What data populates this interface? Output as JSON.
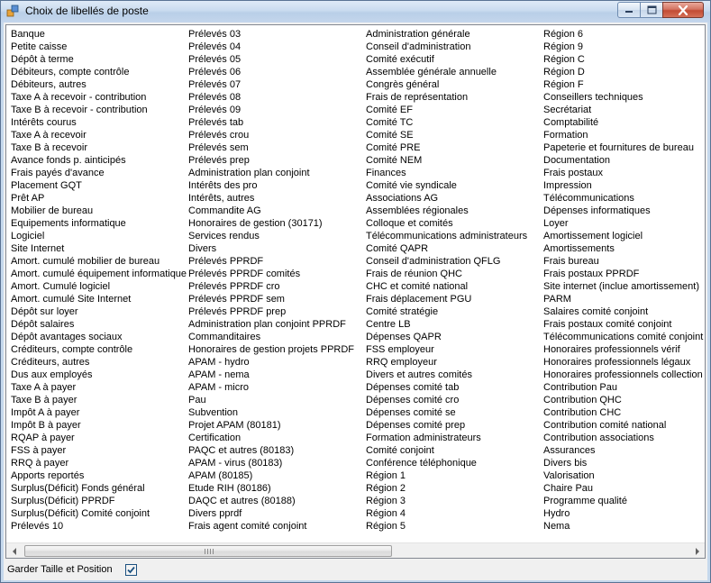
{
  "window": {
    "title": "Choix de libellés de poste"
  },
  "list": {
    "columns": [
      [
        "Banque",
        "Petite caisse",
        "Dépôt à terme",
        "Débiteurs, compte contrôle",
        "Débiteurs, autres",
        "Taxe A à recevoir - contribution",
        "Taxe B à recevoir - contribution",
        "Intérêts courus",
        "Taxe A à recevoir",
        "Taxe B à recevoir",
        "Avance fonds p. ainticipés",
        "Frais payés d'avance",
        "Placement GQT",
        "Prêt AP",
        "Mobilier de bureau",
        "Equipements informatique",
        "Logiciel",
        "Site Internet",
        "Amort. cumulé mobilier de bureau",
        "Amort. cumulé équipement informatique",
        "Amort. Cumulé logiciel",
        "Amort. cumulé Site Internet",
        "Dépôt sur loyer",
        "Dépôt salaires",
        "Dépôt avantages sociaux",
        "Créditeurs, compte contrôle",
        "Créditeurs, autres",
        "Dus aux employés",
        "Taxe A à payer",
        "Taxe B à payer",
        "Impôt A à payer",
        "Impôt B à payer",
        "RQAP à payer",
        "FSS à payer",
        "RRQ à payer",
        "Apports reportés",
        "Surplus(Déficit) Fonds général",
        "Surplus(Déficit) PPRDF",
        "Surplus(Déficit) Comité conjoint",
        "Prélevés 10"
      ],
      [
        "Prélevés 03",
        "Prélevés 04",
        "Prélevés 05",
        "Prélevés 06",
        "Prélevés 07",
        "Prélevés 08",
        "Prélevés 09",
        "Prélevés tab",
        "Prélevés crou",
        "Prélevés sem",
        "Prélevés prep",
        "Administration plan conjoint",
        "Intérêts des pro",
        "Intérêts, autres",
        "Commandite AG",
        "Honoraires de gestion (30171)",
        "Services rendus",
        "Divers",
        "Prélevés PPRDF",
        "Prélevés PPRDF comités",
        "Prélevés PPRDF cro",
        "Prélevés PPRDF sem",
        "Prélevés PPRDF prep",
        "Administration plan conjoint PPRDF",
        "Commanditaires",
        "Honoraires de gestion projets PPRDF",
        "APAM - hydro",
        "APAM - nema",
        "APAM - micro",
        "Pau",
        "Subvention",
        "Projet APAM (80181)",
        "Certification",
        "PAQC et autres (80183)",
        "APAM - virus (80183)",
        "APAM (80185)",
        "Etude RIH (80186)",
        "DAQC et autres (80188)",
        "Divers pprdf",
        "Frais agent comité conjoint"
      ],
      [
        "Administration générale",
        "Conseil d'administration",
        "Comité exécutif",
        "Assemblée générale annuelle",
        "Congrès général",
        "Frais de représentation",
        "Comité EF",
        "Comité TC",
        "Comité SE",
        "Comité PRE",
        "Comité NEM",
        "Finances",
        "Comité vie syndicale",
        "Associations AG",
        "Assemblées régionales",
        "Colloque et comités",
        "Télécommunications administrateurs",
        "Comité QAPR",
        "Conseil d'administration QFLG",
        "Frais de réunion QHC",
        "CHC et comité national",
        "Frais déplacement PGU",
        "Comité stratégie",
        "Centre LB",
        "Dépenses QAPR",
        "FSS employeur",
        "RRQ employeur",
        "Divers et autres comités",
        "Dépenses comité tab",
        "Dépenses comité cro",
        "Dépenses comité se",
        "Dépenses comité prep",
        "Formation administrateurs",
        "Comité conjoint",
        "Conférence téléphonique",
        "Région 1",
        "Région 2",
        "Région 3",
        "Région 4",
        "Région 5"
      ],
      [
        "Région 6",
        "Région 9",
        "Région C",
        "Région D",
        "Région F",
        "Conseillers techniques",
        "Secrétariat",
        "Comptabilité",
        "Formation",
        "Papeterie et fournitures de bureau",
        "Documentation",
        "Frais postaux",
        "Impression",
        "Télécommunications",
        "Dépenses informatiques",
        "Loyer",
        "Amortissement logiciel",
        "Amortissements",
        "Frais bureau",
        "Frais postaux PPRDF",
        "Site internet (inclue amortissement)",
        "PARM",
        "Salaires comité conjoint",
        "Frais postaux comité conjoint",
        "Télécommunications comité conjoint",
        "Honoraires professionnels vérif",
        "Honoraires professionnels légaux",
        "Honoraires professionnels collection",
        "Contribution Pau",
        "Contribution QHC",
        "Contribution CHC",
        "Contribution comité national",
        "Contribution associations",
        "Assurances",
        "Divers bis",
        "Valorisation",
        "Chaire Pau",
        "Programme qualité",
        "Hydro",
        "Nema"
      ]
    ]
  },
  "footer": {
    "keep_label": "Garder Taille et Position",
    "keep_checked": true
  },
  "icons": {
    "app": "app-icon",
    "minimize": "minimize-icon",
    "maximize": "maximize-icon",
    "close": "close-icon"
  },
  "colors": {
    "title_bar": "#c9dbef",
    "close_button": "#c24b34",
    "checkbox_mark": "#1c5180"
  }
}
